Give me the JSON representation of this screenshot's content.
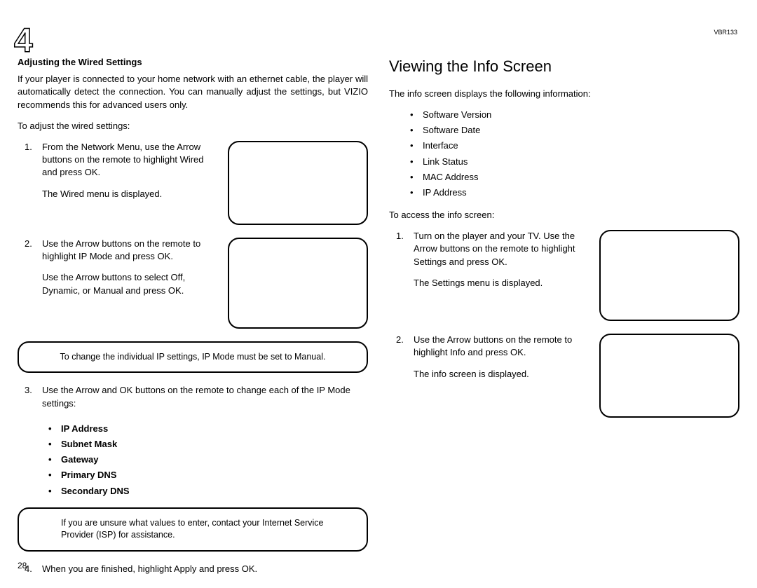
{
  "chapter_number": "4",
  "model_code": "VBR133",
  "page_number": "28",
  "left": {
    "heading": "Adjusting the Wired Settings",
    "intro": "If your player is connected to your home network with an ethernet cable, the player will automatically detect the connection. You can manually adjust the settings, but VIZIO recommends this for advanced users only.",
    "lead": "To adjust the wired settings:",
    "step1a": "From the Network Menu, use the Arrow buttons on the remote to highlight Wired and press OK.",
    "step1b": "The Wired menu is displayed.",
    "step2a": "Use the Arrow buttons on the remote to highlight IP Mode and press OK.",
    "step2b": "Use the Arrow buttons to select Off, Dynamic, or Manual and press OK.",
    "note1": "To change the individual IP settings, IP Mode must be set to Manual.",
    "step3": "Use the Arrow and OK buttons on the remote to change each of the IP Mode settings:",
    "ip_settings": [
      "IP Address",
      "Subnet Mask",
      "Gateway",
      "Primary DNS",
      "Secondary DNS"
    ],
    "note2": "If you are unsure what values to enter, contact your Internet Service Provider (ISP) for assistance.",
    "step4": "When you are finished, highlight Apply and press OK."
  },
  "right": {
    "heading": "Viewing the Info Screen",
    "intro": "The info screen displays the following information:",
    "info_items": [
      "Software Version",
      "Software Date",
      "Interface",
      "Link Status",
      "MAC Address",
      "IP Address"
    ],
    "lead": "To access the info screen:",
    "step1a": "Turn on the player and your TV. Use the Arrow buttons on the remote to highlight Settings and press OK.",
    "step1b": "The Settings menu is displayed.",
    "step2a": "Use the Arrow buttons on the remote to highlight Info and press OK.",
    "step2b": "The info screen is displayed."
  }
}
